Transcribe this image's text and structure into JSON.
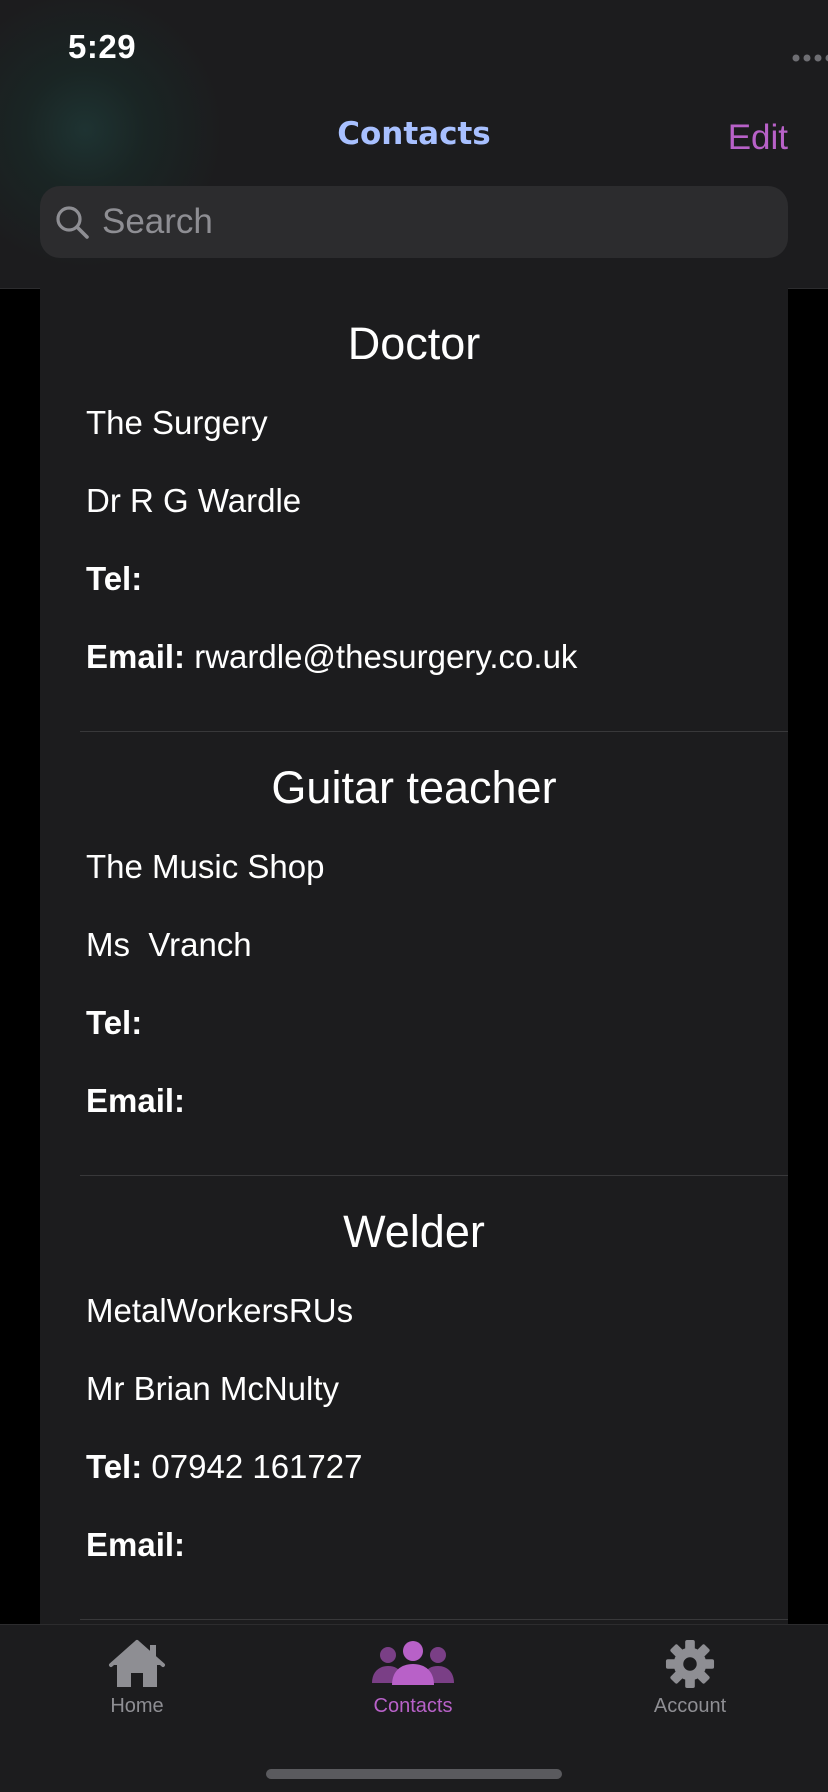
{
  "status_bar": {
    "time": "5:29"
  },
  "nav": {
    "title": "Contacts",
    "edit_label": "Edit"
  },
  "search": {
    "placeholder": "Search",
    "value": ""
  },
  "contacts": [
    {
      "title": "Doctor",
      "company": "The Surgery",
      "name": "Dr R G Wardle",
      "tel_label": "Tel:",
      "tel": "",
      "email_label": "Email:",
      "email": "rwardle@thesurgery.co.uk"
    },
    {
      "title": "Guitar teacher",
      "company": "The Music Shop",
      "name": "Ms  Vranch",
      "tel_label": "Tel:",
      "tel": "",
      "email_label": "Email:",
      "email": ""
    },
    {
      "title": "Welder",
      "company": "MetalWorkersRUs",
      "name": "Mr Brian McNulty",
      "tel_label": "Tel:",
      "tel": "07942 161727",
      "email_label": "Email:",
      "email": ""
    }
  ],
  "tabs": [
    {
      "label": "Home",
      "icon": "home-icon",
      "active": false
    },
    {
      "label": "Contacts",
      "icon": "people-icon",
      "active": true
    },
    {
      "label": "Account",
      "icon": "gear-icon",
      "active": false
    }
  ],
  "colors": {
    "accent": "#b861c8",
    "title": "#a8c0ff",
    "inactive_tab": "#8e8e93",
    "background": "#1c1c1e"
  }
}
